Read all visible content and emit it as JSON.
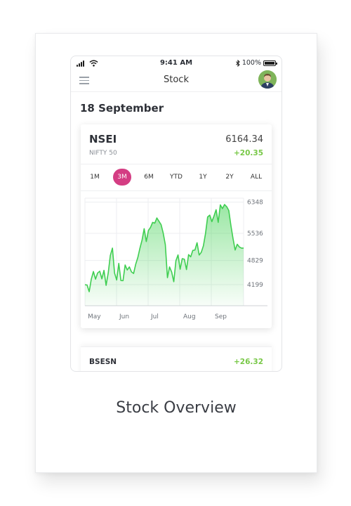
{
  "caption": "Stock Overview",
  "status_bar": {
    "time": "9:41 AM",
    "battery": "100%",
    "battery_level": 1.0
  },
  "app_bar": {
    "title": "Stock"
  },
  "date_heading": "18 September",
  "nsei": {
    "symbol": "NSEI",
    "name": "NIFTY 50",
    "price": "6164.34",
    "change": "+20.35",
    "ranges": [
      "1M",
      "3M",
      "6M",
      "YTD",
      "1Y",
      "2Y",
      "ALL"
    ],
    "selected_range": "3M"
  },
  "bsesn": {
    "symbol": "BSESN",
    "change": "+26.32"
  },
  "colors": {
    "accent": "#d43d83",
    "positive": "#78c847",
    "line": "#3fce51"
  },
  "chart_data": {
    "type": "area",
    "xlabel": "",
    "ylabel": "",
    "x_ticks": [
      "May",
      "Jun",
      "Jul",
      "Aug",
      "Sep"
    ],
    "y_ticks": [
      6348,
      5536,
      4829,
      4199
    ],
    "ylim": [
      3650,
      6450
    ],
    "grid": true,
    "series": [
      {
        "values": [
          4196,
          4190,
          4015,
          4340,
          4540,
          4342,
          4502,
          4548,
          4350,
          4570,
          4180,
          4500,
          4960,
          5150,
          4500,
          4320,
          4752,
          4306,
          4302,
          4710,
          4580,
          4660,
          4530,
          4490,
          4730,
          4905,
          5150,
          5360,
          5655,
          5320,
          5610,
          5690,
          5820,
          5800,
          5935,
          5848,
          5760,
          5540,
          5240,
          4380,
          4660,
          4525,
          4275,
          4820,
          4973,
          4600,
          4876,
          4860,
          4592,
          4980,
          4924,
          5090,
          5100,
          5290,
          4970,
          5040,
          5210,
          5530,
          5960,
          6008,
          5840,
          5985,
          6150,
          5820,
          6275,
          6180,
          6285,
          6230,
          6130,
          5740,
          5400,
          5100,
          5250,
          5180,
          5150,
          5150
        ]
      }
    ]
  }
}
